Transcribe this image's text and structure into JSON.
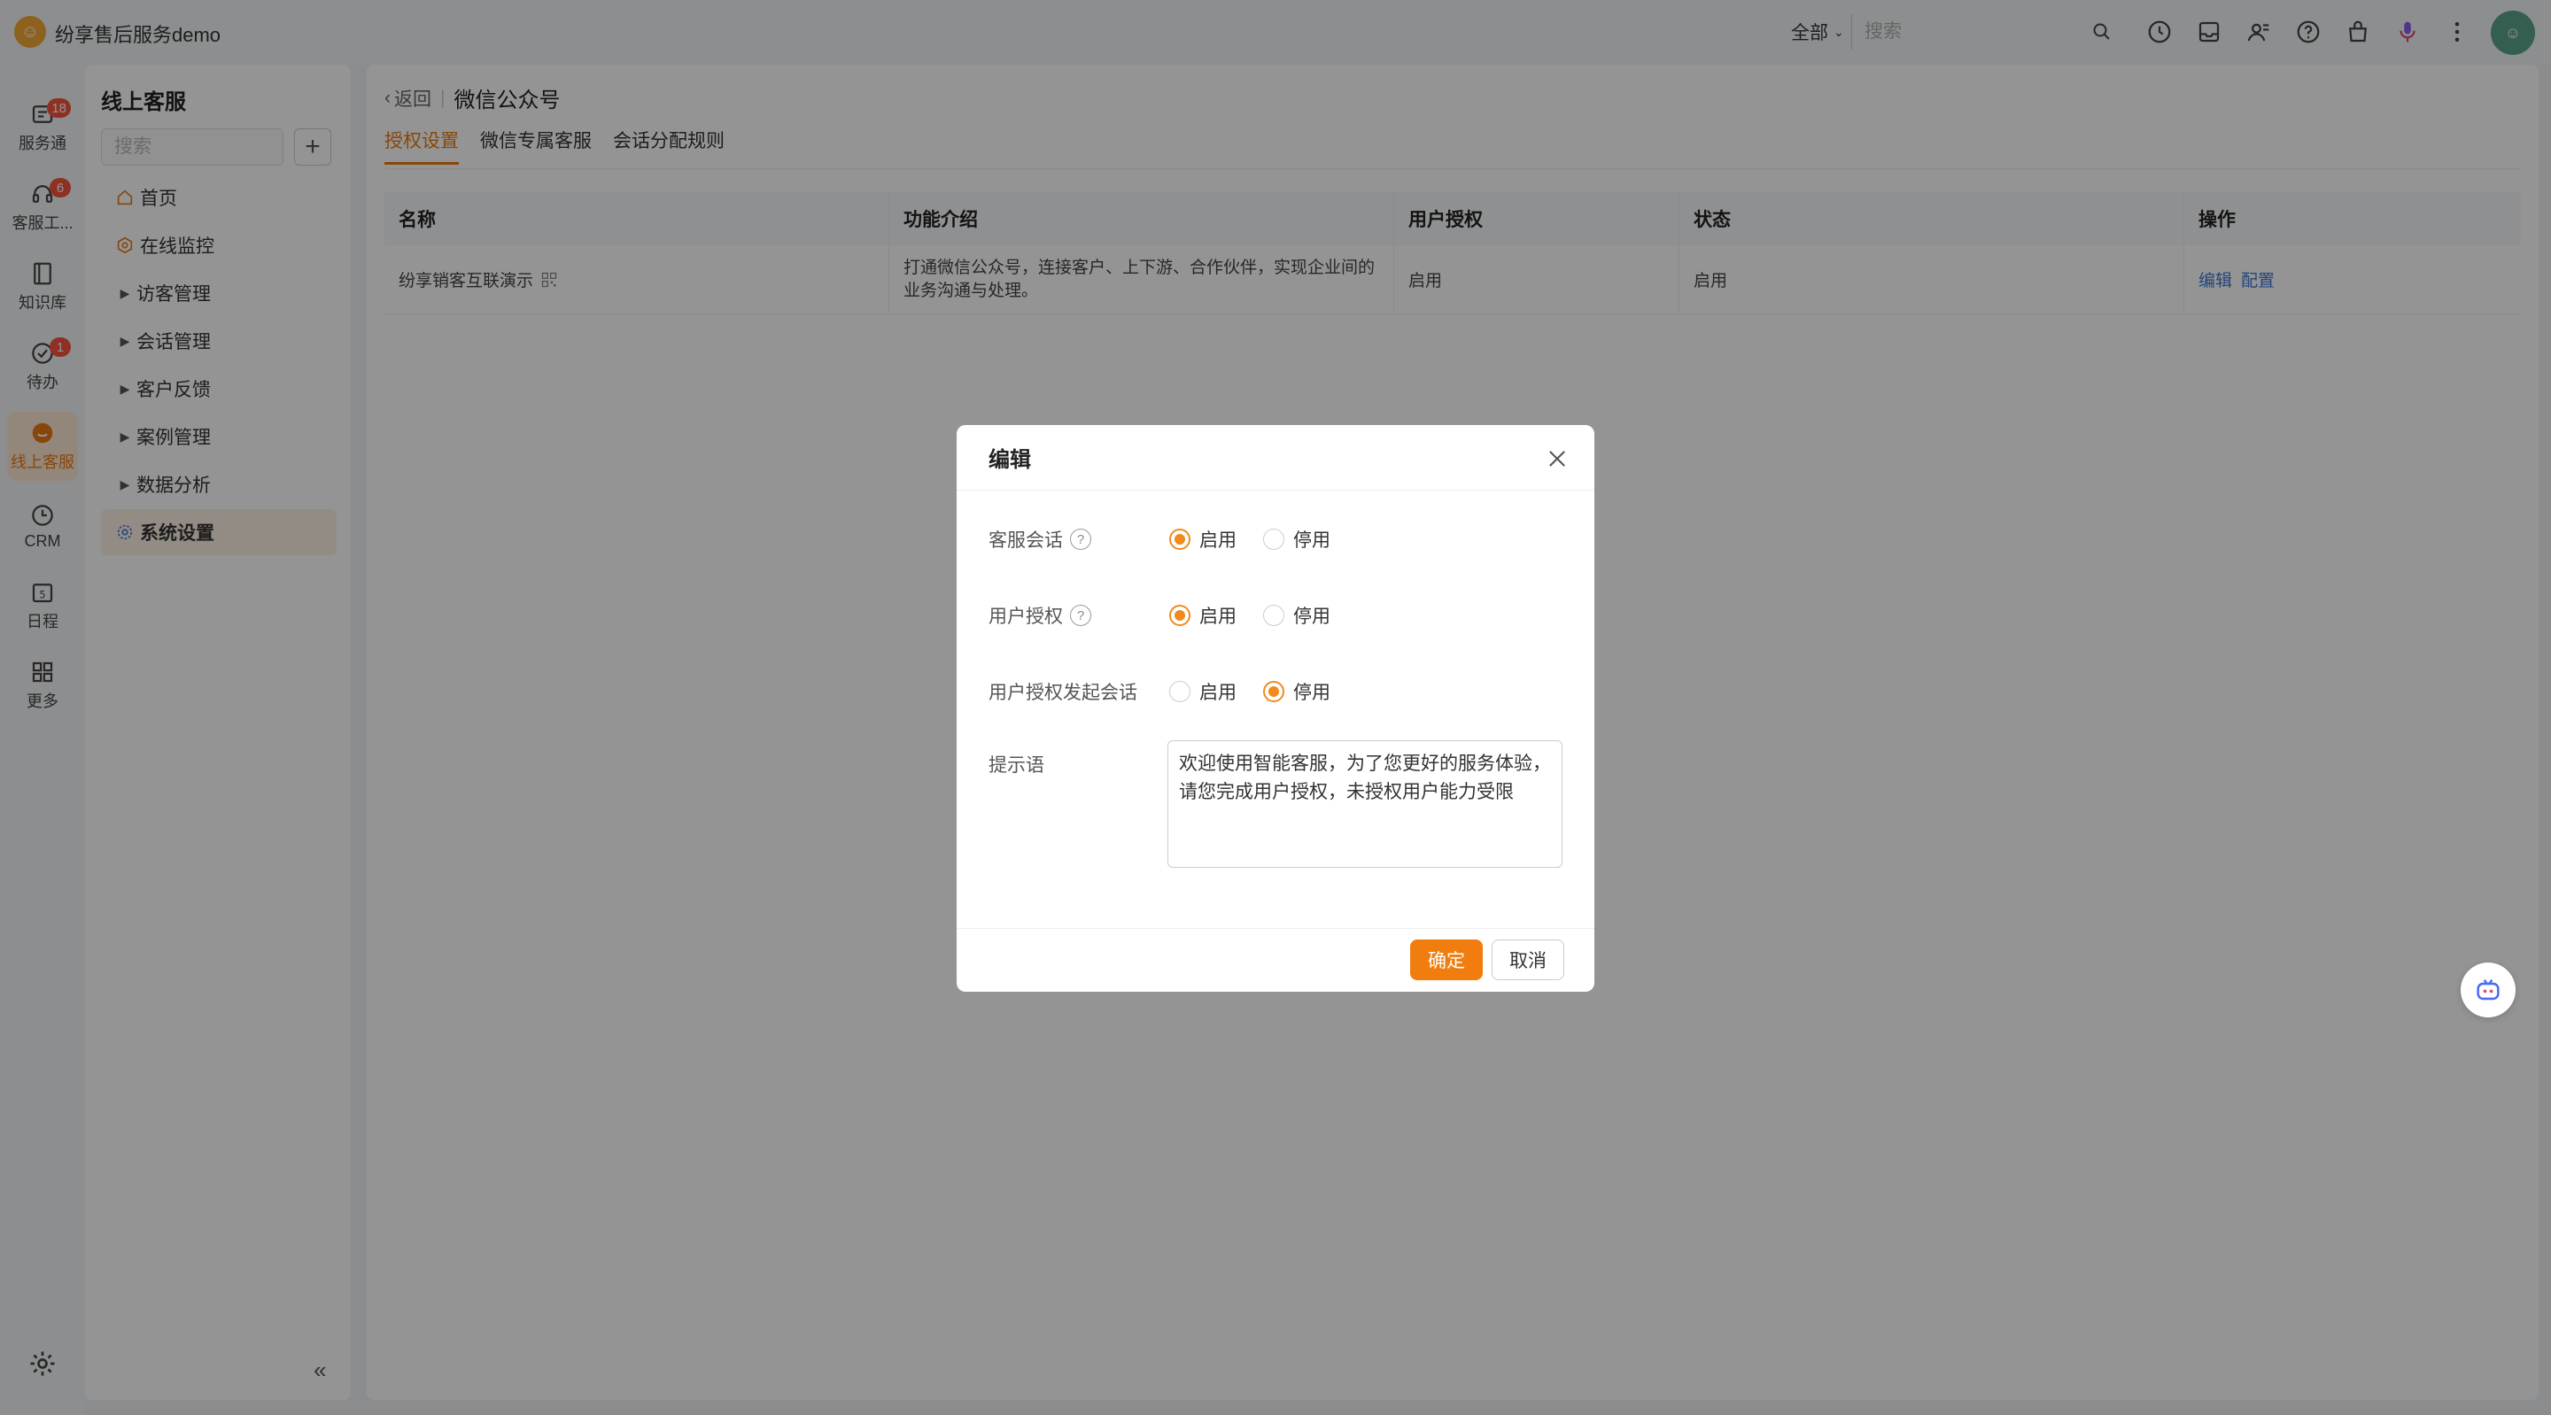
{
  "app": {
    "title": "纷享售后服务demo",
    "accent": "#f07d0e"
  },
  "topbar": {
    "scope": "全部",
    "search_placeholder": "搜索",
    "icons": [
      "clock-icon",
      "inbox-icon",
      "contacts-icon",
      "help-icon",
      "bag-icon",
      "mic-icon",
      "more-icon"
    ]
  },
  "rail": {
    "items": [
      {
        "label": "服务通",
        "badge": "18"
      },
      {
        "label": "客服工...",
        "badge": "6"
      },
      {
        "label": "知识库",
        "badge": ""
      },
      {
        "label": "待办",
        "badge": "1"
      },
      {
        "label": "线上客服",
        "badge": ""
      },
      {
        "label": "CRM",
        "badge": ""
      },
      {
        "label": "日程",
        "badge": ""
      },
      {
        "label": "更多",
        "badge": ""
      }
    ]
  },
  "sidebar": {
    "title": "线上客服",
    "search_placeholder": "搜索",
    "items": [
      {
        "label": "首页"
      },
      {
        "label": "在线监控"
      },
      {
        "label": "访客管理"
      },
      {
        "label": "会话管理"
      },
      {
        "label": "客户反馈"
      },
      {
        "label": "案例管理"
      },
      {
        "label": "数据分析"
      },
      {
        "label": "系统设置"
      }
    ]
  },
  "main": {
    "back": "返回",
    "page_title": "微信公众号",
    "tabs": [
      {
        "label": "授权设置",
        "active": true
      },
      {
        "label": "微信专属客服",
        "active": false
      },
      {
        "label": "会话分配规则",
        "active": false
      }
    ],
    "table": {
      "headers": [
        "名称",
        "功能介绍",
        "用户授权",
        "状态",
        "操作"
      ],
      "rows": [
        {
          "name": "纷享销客互联演示",
          "desc": "打通微信公众号，连接客户、上下游、合作伙伴，实现企业间的业务沟通与处理。",
          "auth": "启用",
          "status": "启用",
          "op_edit": "编辑",
          "op_config": "配置"
        }
      ]
    }
  },
  "modal": {
    "title": "编辑",
    "rows": [
      {
        "label": "客服会话",
        "help": true,
        "opt_on": "启用",
        "opt_off": "停用",
        "value": "on"
      },
      {
        "label": "用户授权",
        "help": true,
        "opt_on": "启用",
        "opt_off": "停用",
        "value": "on"
      },
      {
        "label": "用户授权发起会话",
        "help": false,
        "opt_on": "启用",
        "opt_off": "停用",
        "value": "off"
      }
    ],
    "tip_label": "提示语",
    "tip_text": "欢迎使用智能客服，为了您更好的服务体验，请您完成用户授权，未授权用户能力受限",
    "ok": "确定",
    "cancel": "取消"
  }
}
